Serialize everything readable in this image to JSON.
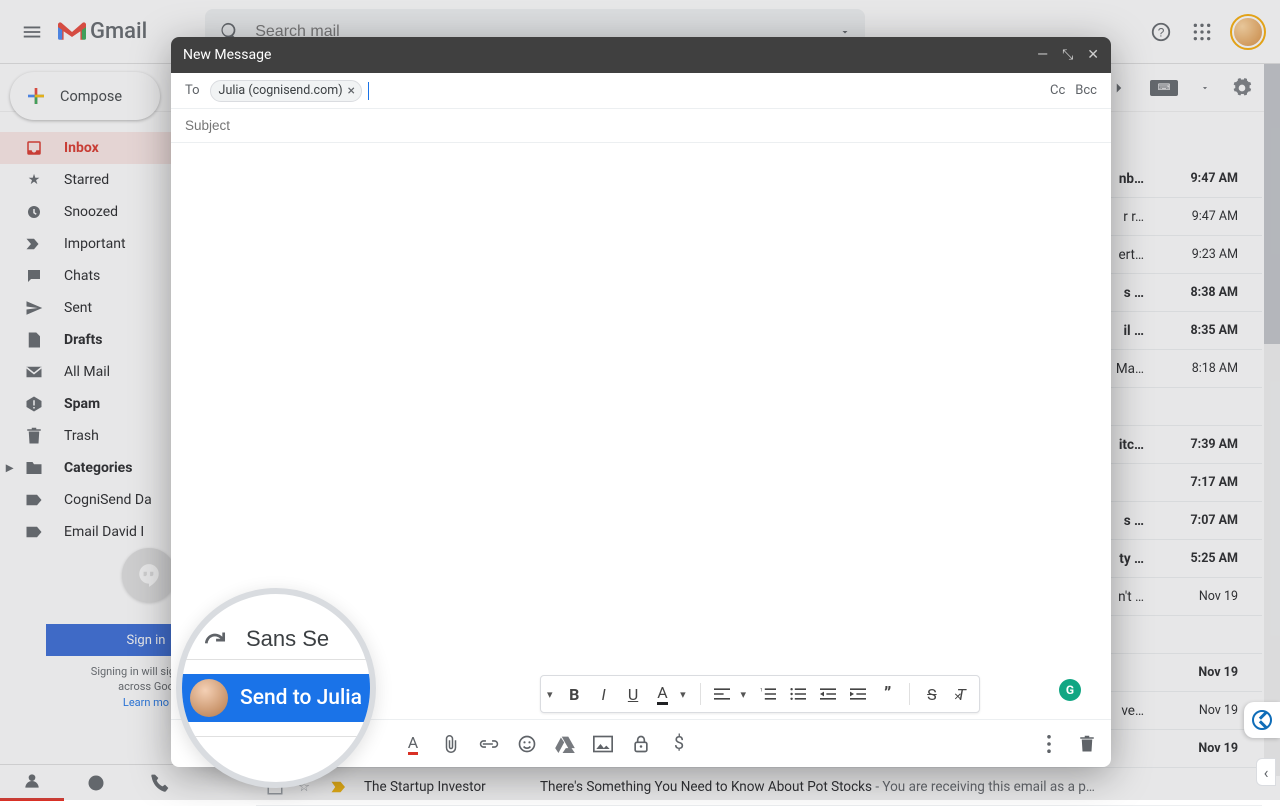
{
  "header": {
    "product": "Gmail",
    "search_placeholder": "Search mail"
  },
  "compose_button": "Compose",
  "nav": [
    {
      "label": "Inbox",
      "icon": "inbox",
      "active": true,
      "bold": true
    },
    {
      "label": "Starred",
      "icon": "star"
    },
    {
      "label": "Snoozed",
      "icon": "clock"
    },
    {
      "label": "Important",
      "icon": "chevr2"
    },
    {
      "label": "Chats",
      "icon": "chat"
    },
    {
      "label": "Sent",
      "icon": "send"
    },
    {
      "label": "Drafts",
      "icon": "file",
      "bold": true
    },
    {
      "label": "All Mail",
      "icon": "mail"
    },
    {
      "label": "Spam",
      "icon": "spam",
      "bold": true
    },
    {
      "label": "Trash",
      "icon": "trash"
    },
    {
      "label": "Categories",
      "icon": "folder",
      "bold": true,
      "caret": true
    },
    {
      "label": "CogniSend Da",
      "icon": "label"
    },
    {
      "label": "Email David I",
      "icon": "label",
      "cut": true
    }
  ],
  "signin": {
    "button": "Sign in",
    "blurb": "Signing in will sign you\nacross Goo",
    "learn": "Learn mo"
  },
  "compose_window": {
    "title": "New Message",
    "to_label": "To",
    "chip": "Julia (cognisend.com)",
    "cc": "Cc",
    "bcc": "Bcc",
    "subject_placeholder": "Subject"
  },
  "magnifier": {
    "font_label": "Sans Se",
    "send_button": "Send to Julia"
  },
  "emails": [
    {
      "snip": "nb…",
      "time": "9:47 AM",
      "unread": true
    },
    {
      "snip": "r r…",
      "time": "9:47 AM"
    },
    {
      "snip": "ert…",
      "time": "9:23 AM"
    },
    {
      "snip": "s …",
      "time": "8:38 AM",
      "unread": true
    },
    {
      "snip": "il …",
      "time": "8:35 AM",
      "unread": true
    },
    {
      "snip": "Ma…",
      "time": "8:18 AM"
    },
    {
      "snip": "",
      "time": ""
    },
    {
      "snip": "itc…",
      "time": "7:39 AM",
      "unread": true
    },
    {
      "snip": "",
      "time": "7:17 AM",
      "unread": true
    },
    {
      "snip": "s …",
      "time": "7:07 AM",
      "unread": true
    },
    {
      "snip": "ty …",
      "time": "5:25 AM",
      "unread": true
    },
    {
      "snip": "n't …",
      "time": "Nov 19"
    },
    {
      "snip": "",
      "time": ""
    },
    {
      "snip": "",
      "time": "Nov 19",
      "unread": true
    },
    {
      "snip": "ve…",
      "time": "Nov 19"
    },
    {
      "snip": "",
      "time": "Nov 19",
      "unread": true
    }
  ],
  "full_row": {
    "from": "The Startup Investor",
    "subject": "There's Something You Need to Know About Pot Stocks",
    "preview": " - You are receiving this email as a p…"
  }
}
